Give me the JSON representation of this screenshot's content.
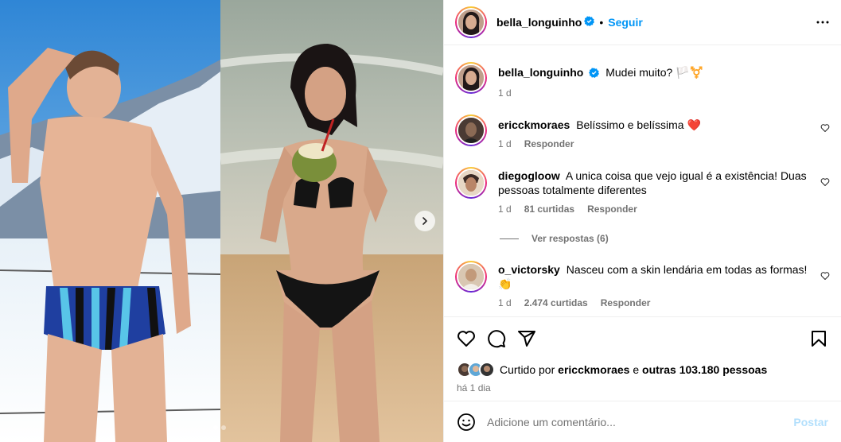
{
  "post": {
    "author": "bella_longuinho",
    "follow_label": "Seguir",
    "separator": "•",
    "caption": "Mudei muito? 🏳️⚧️",
    "caption_age": "1 d"
  },
  "comments": [
    {
      "user": "ericckmoraes",
      "text": "Belíssimo e belíssima ❤️",
      "age": "1 d",
      "likes": "",
      "reply_label": "Responder"
    },
    {
      "user": "diegogloow",
      "text": "A unica coisa que vejo igual é a existência! Duas pessoas totalmente diferentes",
      "age": "1 d",
      "likes": "81 curtidas",
      "reply_label": "Responder"
    },
    {
      "user": "o_victorsky",
      "text": "Nasceu com a skin lendária em todas as formas! 👏",
      "age": "1 d",
      "likes": "2.474 curtidas",
      "reply_label": "Responder"
    }
  ],
  "view_replies": "Ver respostas (6)",
  "likes": {
    "prefix": "Curtido por",
    "user": "ericckmoraes",
    "connector": "e",
    "others": "outras 103.180 pessoas",
    "time_ago": "há 1 dia"
  },
  "composer": {
    "placeholder": "Adicione um comentário...",
    "post_label": "Postar"
  },
  "carousel": {
    "slides": 2,
    "current": 1
  },
  "icons": [
    "verified-badge-icon",
    "more-options-icon",
    "heart-icon",
    "comment-icon",
    "share-icon",
    "bookmark-icon",
    "emoji-icon",
    "chevron-right-icon"
  ],
  "colors": {
    "accent": "#0095f6",
    "verified": "#0095f6",
    "meta_text": "#737373",
    "post_disabled": "#b2dffc",
    "like_heart": "#ed4956"
  }
}
